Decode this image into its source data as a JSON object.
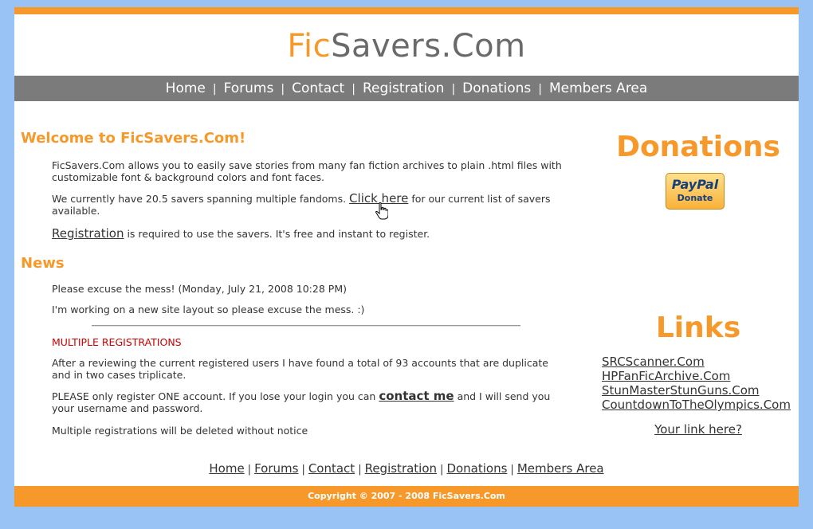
{
  "logo": {
    "part1": "Fic",
    "part2": "Savers.Com"
  },
  "nav": [
    "Home",
    "Forums",
    "Contact",
    "Registration",
    "Donations",
    "Members Area"
  ],
  "nav_separator": "|",
  "welcome": {
    "heading": "Welcome to FicSavers.Com!",
    "intro": "FicSavers.Com allows you to easily save stories from many fan fiction archives to plain .html files with customizable font & background colors and font faces.",
    "savers_before": "We currently have 20.5 savers spanning multiple fandoms. ",
    "savers_link": "Click here",
    "savers_after": " for our current list of savers available.",
    "register_link": "Registration",
    "register_after": " is required to use the savers. It's free and instant to register."
  },
  "news": {
    "heading": "News",
    "date": "Please excuse the mess! (Monday, July 21, 2008 10:28 PM)",
    "message": "I'm working on a new site layout so please excuse the mess. :)",
    "multi_heading": "MULTIPLE REGISTRATIONS",
    "multi_p1": "After a reviewing the current registered users I have found a total of 93 accounts that are duplicate and in two cases triplicate.",
    "multi_p2_before": "PLEASE only register ONE account. If you lose your login you can ",
    "multi_p2_link": "contact me",
    "multi_p2_after": " and I will send you your username and password.",
    "multi_p3": "Multiple registrations will be deleted without notice"
  },
  "donations": {
    "title": "Donations",
    "paypal_word": "PayPal",
    "paypal_sub": "Donate"
  },
  "links": {
    "title": "Links",
    "items": [
      "SRCScanner.Com",
      "HPFanFicArchive.Com",
      "StunMasterStunGuns.Com",
      "CountdownToTheOlympics.Com"
    ],
    "your_link": "Your link here?"
  },
  "footer": {
    "copyright": "Copyright © 2007 - 2008 FicSavers.Com"
  },
  "colors": {
    "accent": "#f7992a",
    "nav_bg": "#7b7b7b",
    "page_bg": "#99c2f5",
    "alert": "#cc0000"
  }
}
